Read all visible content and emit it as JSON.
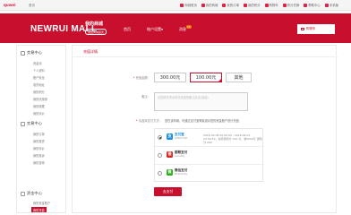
{
  "topbar": {
    "logo": "quwei",
    "home": "首页",
    "links": [
      "商城首页",
      "我的商城",
      "我的订单",
      "我的积分",
      "购物车",
      "积分兑换",
      "帮助中心",
      "手机版"
    ]
  },
  "header": {
    "brand": "NEWRUI MALL",
    "mine_title": "我的商城",
    "mine_sub": "返回商城首页",
    "nav": [
      {
        "label": "首页"
      },
      {
        "label": "账户设置",
        "arrow": "▾"
      },
      {
        "label": "消息",
        "badge": "18"
      }
    ],
    "cart": "购物车"
  },
  "sidebar": {
    "sections": [
      {
        "title": "交易中心",
        "items": [
          "资金池",
          "个人资料",
          "账户安全",
          "收货地址",
          "我的积分",
          "我的优惠券",
          "我的收藏",
          "我的评价"
        ]
      },
      {
        "title": "交易中心",
        "items": [
          "我的订单",
          "我的退货",
          "我的评价",
          "我的投诉",
          "我的咨询"
        ]
      },
      {
        "title": "资金中心",
        "items": [
          "我的资金账户",
          "我的充值"
        ]
      }
    ],
    "active_item": "我的充值"
  },
  "content": {
    "tab": "充值详情",
    "amount_label": "充值金额",
    "amounts": [
      "300.00元",
      "100.00元",
      "其他"
    ],
    "selected_amount": 1,
    "remark_label": "备注",
    "remark_placeholder": "请您填写您对本次充值的备注信息(选填)",
    "tip_label": "请选择支付方式",
    "tip_text": "您在该商城，可通过支付宝等渠道对您的资金账户进行充值",
    "payments": [
      {
        "name": "支付宝",
        "sub": "ALIPAY.COM",
        "icon": "alipay-icon",
        "color": "#1a8fe0",
        "glyph": "支",
        "note": "2016-05-08 00:00:00 - 2016-06-01 23:59:59，充值送积分 100 分，满5000元 送积分 200",
        "selected": true
      },
      {
        "name": "银联支付",
        "sub": "UnionPay",
        "icon": "unionpay-icon",
        "color": "#d6281e",
        "glyph": "银",
        "note": "",
        "selected": false
      },
      {
        "name": "微信支付",
        "sub": "WeChat Pay",
        "icon": "wechat-pay-icon",
        "color": "#2ab016",
        "glyph": "微",
        "note": "",
        "selected": false
      }
    ],
    "submit": "去支付"
  },
  "colors": {
    "brand_red": "#c8102e",
    "alipay": "#1a8fe0",
    "unionpay": "#d6281e",
    "wechat": "#2ab016"
  }
}
